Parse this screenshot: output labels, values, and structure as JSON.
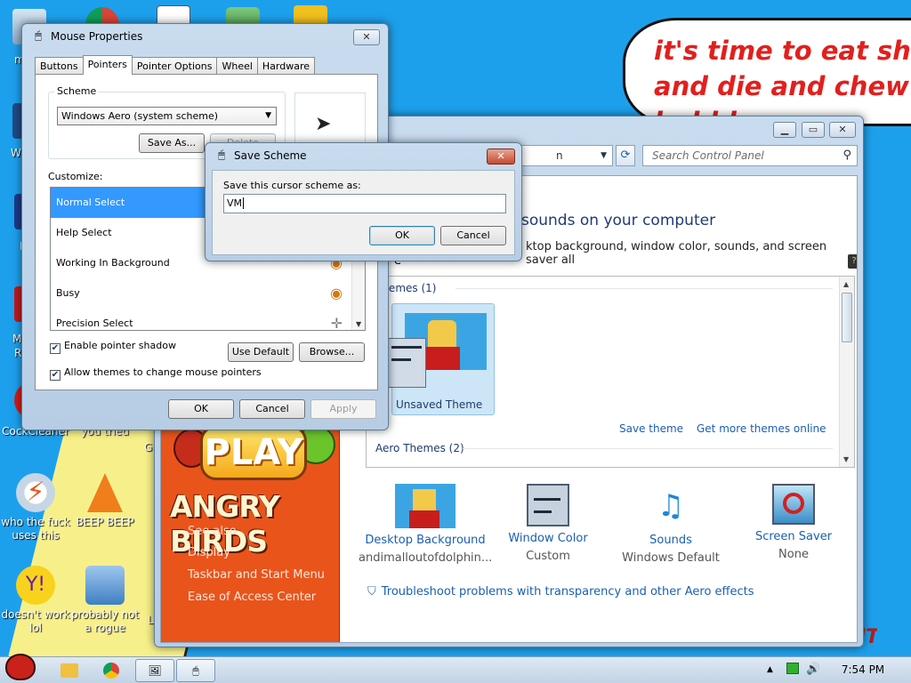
{
  "wallpaper": {
    "speech_lines": [
      "it's time to eat shit",
      "and die and chew",
      "bubble gum"
    ],
    "corner_text": "FINGLENT"
  },
  "desktop_icons": [
    {
      "label": "CockCleaner"
    },
    {
      "label": "you tried"
    },
    {
      "label": "who the fuck uses this"
    },
    {
      "label": "BEEP BEEP"
    },
    {
      "label": "doesn't work lol"
    },
    {
      "label": "probably not a rogue"
    }
  ],
  "desktop_partial_labels": [
    "m",
    "W",
    "L",
    "M",
    "R",
    "G",
    "L"
  ],
  "control_panel": {
    "address_suffix": "n",
    "search_placeholder": "Search Control Panel",
    "heading": "sounds on your computer",
    "subtext": "ktop background, window color, sounds, and screen saver all",
    "subtext_tail": "e",
    "my_themes_label": "Themes (1)",
    "unsaved_theme_label": "Unsaved Theme",
    "save_theme_link": "Save theme",
    "more_themes_link": "Get more themes online",
    "aero_themes_label": "Aero Themes (2)",
    "left_links": {
      "see_also": "See also",
      "items": [
        "Display",
        "Taskbar and Start Menu",
        "Ease of Access Center"
      ]
    },
    "play_text": "PLAY",
    "angry_birds_text": "ANGRY BIRDS",
    "items": [
      {
        "title": "Desktop Background",
        "sub": "andimalloutofdolphin..."
      },
      {
        "title": "Window Color",
        "sub": "Custom"
      },
      {
        "title": "Sounds",
        "sub": "Windows Default"
      },
      {
        "title": "Screen Saver",
        "sub": "None"
      }
    ],
    "troubleshoot_link": "Troubleshoot problems with transparency and other Aero effects"
  },
  "mouse_properties": {
    "title": "Mouse Properties",
    "tabs": [
      "Buttons",
      "Pointers",
      "Pointer Options",
      "Wheel",
      "Hardware"
    ],
    "active_tab": "Pointers",
    "scheme_legend": "Scheme",
    "scheme_value": "Windows Aero (system scheme)",
    "save_as_label": "Save As...",
    "delete_label": "Delete",
    "customize_label": "Customize:",
    "cursor_list": [
      {
        "name": "Normal Select",
        "selected": true
      },
      {
        "name": "Help Select",
        "selected": false
      },
      {
        "name": "Working In Background",
        "selected": false
      },
      {
        "name": "Busy",
        "selected": false
      },
      {
        "name": "Precision Select",
        "selected": false
      }
    ],
    "enable_shadow_label": "Enable pointer shadow",
    "enable_shadow_checked": true,
    "allow_themes_label": "Allow themes to change mouse pointers",
    "allow_themes_checked": true,
    "use_default_label": "Use Default",
    "browse_label": "Browse...",
    "ok_label": "OK",
    "cancel_label": "Cancel",
    "apply_label": "Apply"
  },
  "save_scheme_dialog": {
    "title": "Save Scheme",
    "prompt": "Save this cursor scheme as:",
    "value": "VM",
    "ok_label": "OK",
    "cancel_label": "Cancel"
  },
  "taskbar": {
    "clock": "7:54 PM"
  },
  "colors": {
    "desktop_bg": "#1da0ec",
    "selection": "#3399ff",
    "link": "#1a5fb4",
    "speech_text": "#e1201e",
    "cp_left_panel": "#e9541b"
  }
}
